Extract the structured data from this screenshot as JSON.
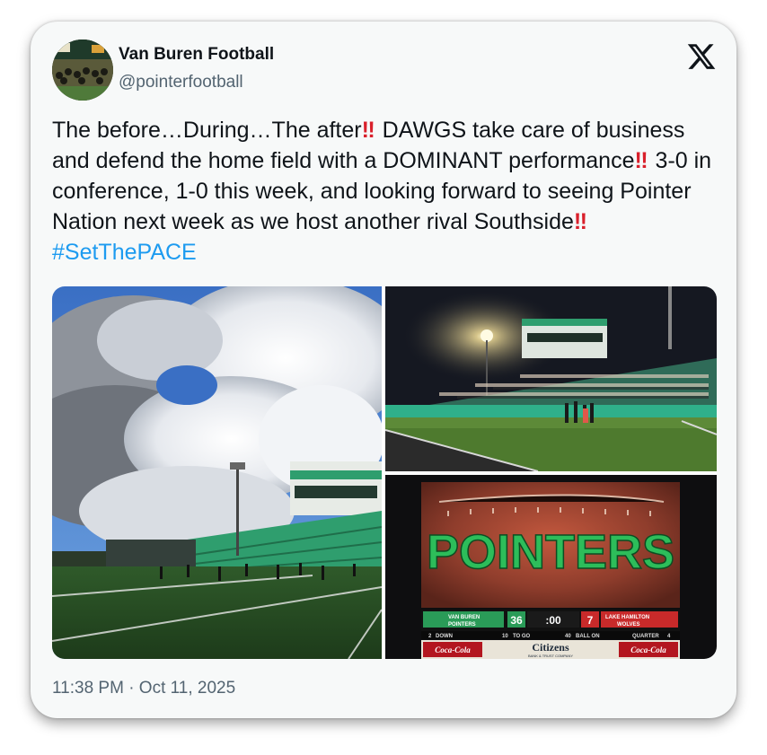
{
  "tweet": {
    "account_name": "Van Buren Football",
    "handle": "@pointerfootball",
    "text_parts": [
      "The before…During…The after",
      " DAWGS take care of business and defend the home field with a DOMINANT performance",
      " 3-0 in conference, 1-0 this week, and looking forward to seeing Pointer Nation next week as we host another rival Southside",
      " "
    ],
    "emphasis_glyph": "‼",
    "hashtag": "#SetThePACE",
    "timestamp": "11:38 PM · Oct 11, 2025"
  },
  "icons": {
    "platform_logo": "x-logo-icon"
  },
  "scoreboard": {
    "banner": "POINTERS",
    "home_name_line1": "VAN BUREN",
    "home_name_line2": "POINTERS",
    "home_score": "36",
    "clock": ":00",
    "away_score": "7",
    "away_name_line1": "LAKE HAMILTON",
    "away_name_line2": "WOLVES",
    "down": "2",
    "down_label": "DOWN",
    "to_go": "10",
    "to_go_label": "TO GO",
    "ball_on": "40",
    "ball_on_label": "BALL ON",
    "quarter": "4",
    "quarter_label": "QUARTER",
    "sponsor_left": "Coca-Cola",
    "sponsor_center": "Citizens",
    "sponsor_center_sub": "BANK & TRUST COMPANY",
    "sponsor_right": "Coca-Cola"
  },
  "colors": {
    "hashtag": "#1d9bf0",
    "emphasis": "#d9202b",
    "stadium_green": "#2f9e6e",
    "scoreboard_green": "#2dbd5a"
  }
}
